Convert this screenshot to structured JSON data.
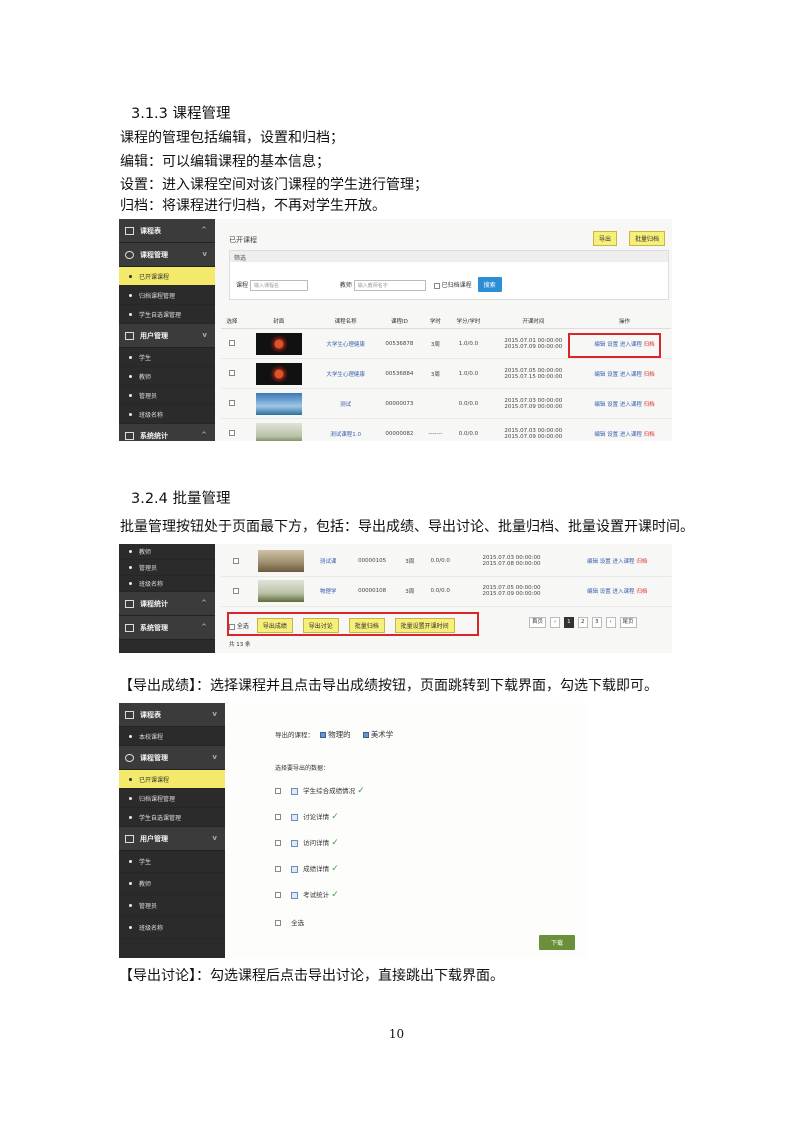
{
  "section1": {
    "heading": "3.1.3 课程管理",
    "lines": [
      "课程的管理包括编辑，设置和归档；",
      "编辑：可以编辑课程的基本信息；",
      "设置：进入课程空间对该门课程的学生进行管理；",
      "归档：将课程进行归档，不再对学生开放。"
    ]
  },
  "shot1": {
    "sidebar": {
      "group_1": "课程表",
      "group_2": "课程管理",
      "items_2": [
        "已开课课程",
        "归档课程管理",
        "学生自选课管理"
      ],
      "active_item": "已开课课程",
      "group_3": "用户管理",
      "items_3": [
        "学生",
        "教师",
        "管理员",
        "班级名称"
      ],
      "group_4": "系统统计"
    },
    "page_title": "已开课程",
    "buttons": {
      "export": "导出",
      "batch_archive": "批量归档"
    },
    "filter": {
      "panel_title": "筛选",
      "course_label": "课程",
      "course_placeholder": "输入课程名",
      "teacher_label": "教师",
      "teacher_placeholder": "输入教师名字",
      "archived_label": "已归档课程",
      "search_button": "搜索"
    },
    "columns": [
      "选择",
      "封面",
      "课程名称",
      "课程ID",
      "学时",
      "学分/学时",
      "开课时间",
      "操作"
    ],
    "rows": [
      {
        "thumb": "red",
        "name": "大学生心理健康",
        "id": "00536878",
        "hours": "3周",
        "credit": "1.0/0.0",
        "time1": "2015.07.01 00:00:00",
        "time2": "2015.07.09 00:00:00",
        "ops": [
          "编辑",
          "设置",
          "进入课程",
          "归档"
        ]
      },
      {
        "thumb": "red",
        "name": "大学生心理健康",
        "id": "00536884",
        "hours": "3周",
        "credit": "1.0/0.0",
        "time1": "2015.07.05 00:00:00",
        "time2": "2015.07.15 00:00:00",
        "ops": [
          "编辑",
          "设置",
          "进入课程",
          "归档"
        ]
      },
      {
        "thumb": "sea",
        "name": "测试",
        "id": "00000073",
        "hours": "",
        "credit": "0.0/0.0",
        "time1": "2015.07.03 00:00:00",
        "time2": "2015.07.09 00:00:00",
        "ops": [
          "编辑",
          "设置",
          "进入课程",
          "归档"
        ]
      },
      {
        "thumb": "field",
        "name": "测试课程1.0",
        "id": "00000082",
        "hours": "-------",
        "credit": "0.0/0.0",
        "time1": "2015.07.03 00:00:00",
        "time2": "2015.07.09 00:00:00",
        "ops": [
          "编辑",
          "设置",
          "进入课程",
          "归档"
        ]
      }
    ]
  },
  "section2": {
    "heading": "3.2.4 批量管理",
    "line": "批量管理按钮处于页面最下方，包括：导出成绩、导出讨论、批量归档、批量设置开课时间。"
  },
  "shot2": {
    "sidebar": {
      "items_top": [
        "教师",
        "管理员",
        "班级名称"
      ],
      "group_a": "课程统计",
      "group_b": "系统管理"
    },
    "rows": [
      {
        "thumb": "people",
        "name": "测试课",
        "id": "00000105",
        "hours": "3周",
        "credit": "0.0/0.0",
        "time1": "2015.07.03 00:00:00",
        "time2": "2015.07.08 00:00:00",
        "ops": [
          "编辑",
          "设置",
          "进入课程",
          "归档"
        ]
      },
      {
        "thumb": "field",
        "name": "物理学",
        "id": "00000108",
        "hours": "3周",
        "credit": "0.0/0.0",
        "time1": "2015.07.05 00:00:00",
        "time2": "2015.07.09 00:00:00",
        "ops": [
          "编辑",
          "设置",
          "进入课程",
          "归档"
        ]
      }
    ],
    "select_all": "全选",
    "batch_buttons": [
      "导出成绩",
      "导出讨论",
      "批量归档",
      "批量设置开课时间"
    ],
    "pager": {
      "prev": "首页",
      "lt": "‹",
      "pages": [
        "1",
        "2",
        "3"
      ],
      "current": "1",
      "gt": "›",
      "last": "尾页"
    },
    "total": "共 13 条"
  },
  "section3": {
    "line": "【导出成绩】：选择课程并且点击导出成绩按钮，页面跳转到下载界面，勾选下载即可。"
  },
  "shot3": {
    "sidebar": {
      "group_1": "课程表",
      "items_1": [
        "本校课程"
      ],
      "group_2": "课程管理",
      "items_2": [
        "已开课课程",
        "归档课程管理",
        "学生自选课管理"
      ],
      "active_item": "已开课课程",
      "group_3": "用户管理",
      "items_3": [
        "学生",
        "教师",
        "管理员",
        "班级名称"
      ]
    },
    "exported_label": "导出的课程：",
    "courses": [
      "物理的",
      "美术学"
    ],
    "select_label": "选择要导出的数据：",
    "options": [
      "学生综合成绩情况",
      "讨论详情",
      "访问详情",
      "成绩详情",
      "考试统计"
    ],
    "select_all": "全选",
    "download_button": "下载"
  },
  "section4": {
    "line": "【导出讨论】：勾选课程后点击导出讨论，直接跳出下载界面。"
  },
  "page_number": "10"
}
